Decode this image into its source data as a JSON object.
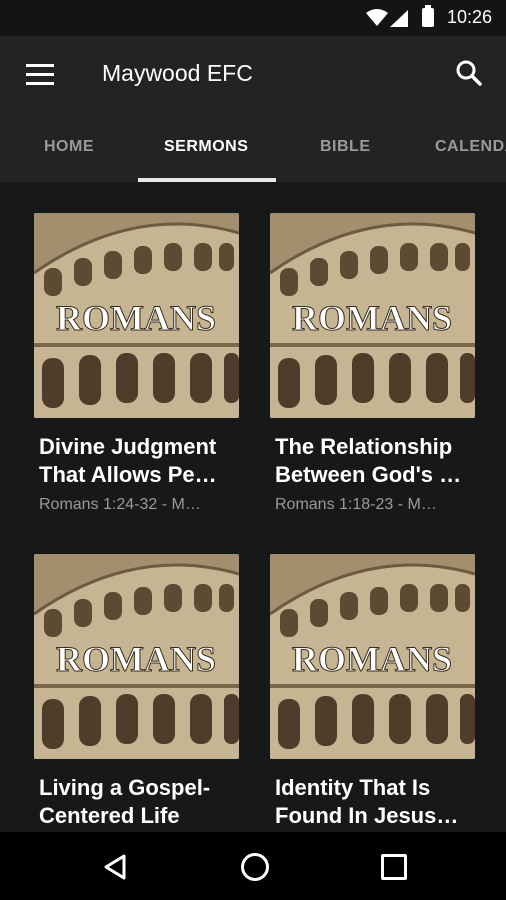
{
  "status_bar": {
    "time": "10:26",
    "icons": [
      "wifi-icon",
      "signal-icon",
      "battery-icon"
    ]
  },
  "app_bar": {
    "title": "Maywood EFC",
    "menu_icon": "menu-icon",
    "search_icon": "search-icon"
  },
  "tabs": [
    {
      "label": "HOME",
      "active": false
    },
    {
      "label": "SERMONS",
      "active": true
    },
    {
      "label": "BIBLE",
      "active": false
    },
    {
      "label": "CALENDAR",
      "active": false
    }
  ],
  "sermons": [
    {
      "image_text": "ROMANS",
      "title_line1": "Divine Judgment",
      "title_line2": "That Allows Pe…",
      "subtitle": "Romans 1:24-32 - M…"
    },
    {
      "image_text": "ROMANS",
      "title_line1": "The Relationship",
      "title_line2": "Between God's …",
      "subtitle": "Romans 1:18-23 - M…"
    },
    {
      "image_text": "ROMANS",
      "title_line1": "Living a Gospel-",
      "title_line2": "Centered Life",
      "subtitle": ""
    },
    {
      "image_text": "ROMANS",
      "title_line1": "Identity That Is",
      "title_line2": "Found In Jesus…",
      "subtitle": ""
    }
  ],
  "nav_bar": {
    "icons": [
      "back-icon",
      "home-icon",
      "recent-apps-icon"
    ]
  },
  "colors": {
    "background": "#17181a",
    "app_bar": "#222324",
    "accent": "#ffffff",
    "muted_text": "#9a9a9a",
    "thumb_sepia": "#a38f6e"
  }
}
